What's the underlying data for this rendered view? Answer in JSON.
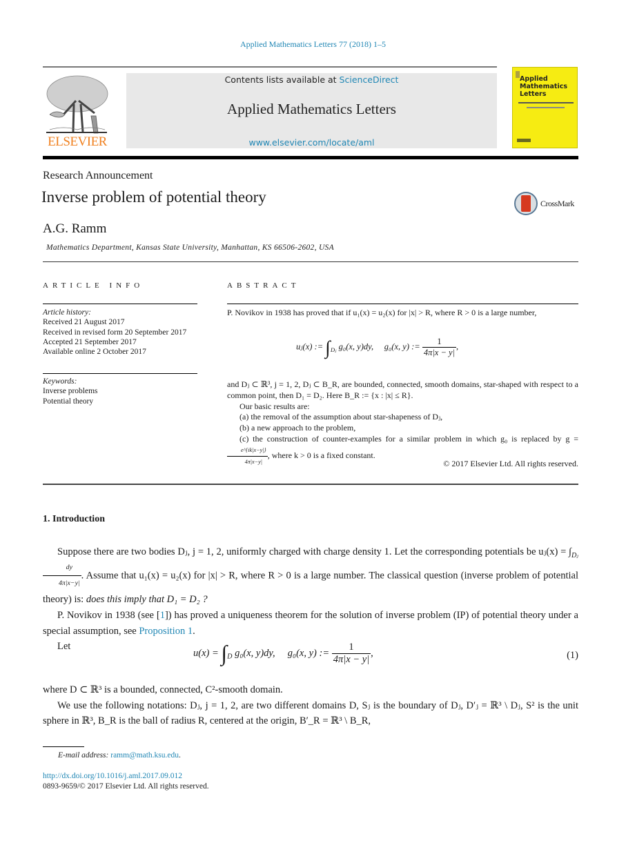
{
  "running_head": "Applied Mathematics Letters 77 (2018) 1–5",
  "masthead": {
    "publisher_logo_label": "ELSEVIER",
    "contents_prefix": "Contents lists available at ",
    "contents_link": "ScienceDirect",
    "journal_title": "Applied Mathematics Letters",
    "journal_url": "www.elsevier.com/locate/aml",
    "cover_title_lines": [
      "Applied",
      "Mathematics",
      "Letters"
    ]
  },
  "article": {
    "type": "Research Announcement",
    "title": "Inverse problem of potential theory",
    "crossmark_label": "CrossMark",
    "author": "A.G. Ramm",
    "affiliation": "Mathematics Department, Kansas State University, Manhattan, KS 66506-2602, USA"
  },
  "article_info": {
    "heading": "ARTICLE INFO",
    "history_label": "Article history:",
    "history": [
      "Received 21 August 2017",
      "Received in revised form 20 September 2017",
      "Accepted 21 September 2017",
      "Available online 2 October 2017"
    ],
    "keywords_label": "Keywords:",
    "keywords": [
      "Inverse problems",
      "Potential theory"
    ]
  },
  "abstract": {
    "heading": "ABSTRACT",
    "p1": "P. Novikov in 1938 has proved that if u₁(x) = u₂(x) for |x| > R, where R > 0 is a large number,",
    "eq_lhs": "uⱼ(x) :=",
    "eq_int_sub": "Dⱼ",
    "eq_integrand": "g₀(x, y)dy,",
    "eq_g0": "g₀(x, y) :=",
    "eq_num": "1",
    "eq_den": "4π|x − y|",
    "p2": "and Dⱼ ⊂ ℝ³, j = 1, 2, Dⱼ ⊂ B_R, are bounded, connected, smooth domains, star-shaped with respect to a common point, then D₁ = D₂. Here B_R := {x : |x| ≤ R}.",
    "results_intro": "Our basic results are:",
    "result_a": "(a) the removal of the assumption about star-shapeness of Dⱼ,",
    "result_b": "(b) a new approach to the problem,",
    "result_c_1": "(c) the construction of counter-examples for a similar problem in which g₀ is replaced by g = ",
    "result_c_num": "e^{ik|x−y|}",
    "result_c_den": "4π|x−y|",
    "result_c_2": ", where k > 0 is a fixed constant.",
    "copyright": "© 2017 Elsevier Ltd. All rights reserved."
  },
  "section1": {
    "heading": "1.  Introduction",
    "p1_a": "Suppose there are two bodies Dⱼ, j = 1, 2, uniformly charged with charge density 1. Let the corresponding potentials be uⱼ(x) = ∫",
    "p1_int_sub": "Dⱼ",
    "p1_frac_num": "dy",
    "p1_frac_den": "4π|x−y|",
    "p1_b": ". Assume that u₁(x) = u₂(x) for |x| > R, where R > 0 is a large number. The classical question (inverse problem of potential theory) is: ",
    "p1_question": "does this imply that D₁ = D₂ ?",
    "p2_a": "P. Novikov in 1938 (see [",
    "p2_ref": "1",
    "p2_b": "]) has proved a uniqueness theorem for the solution of inverse problem (IP) of potential theory under a special assumption, see ",
    "p2_prop_link": "Proposition 1",
    "p2_c": ".",
    "p3": "Let",
    "eq1_lhs": "u(x) =",
    "eq1_int_sub": "D",
    "eq1_integrand": "g₀(x, y)dy,",
    "eq1_g0": "g₀(x, y) :=",
    "eq1_num": "1",
    "eq1_den": "4π|x − y|",
    "eq1_tail": ",",
    "eq1_number": "(1)",
    "p4": "where D ⊂ ℝ³ is a bounded, connected, C²-smooth domain.",
    "p5": "We use the following notations: Dⱼ, j = 1, 2, are two different domains D, Sⱼ is the boundary of Dⱼ, D′ⱼ = ℝ³ \\ Dⱼ, S² is the unit sphere in ℝ³, B_R is the ball of radius R, centered at the origin, B′_R = ℝ³ \\ B_R,"
  },
  "footer": {
    "email_label": "E-mail address: ",
    "email": "ramm@math.ksu.edu",
    "email_tail": ".",
    "doi": "http://dx.doi.org/10.1016/j.aml.2017.09.012",
    "issn_copyright": "0893-9659/© 2017 Elsevier Ltd. All rights reserved."
  },
  "colors": {
    "link": "#1f86b4",
    "elsevier_orange": "#f08120",
    "cover_yellow": "#f6ec12",
    "masthead_gray": "#e8e8e8"
  }
}
